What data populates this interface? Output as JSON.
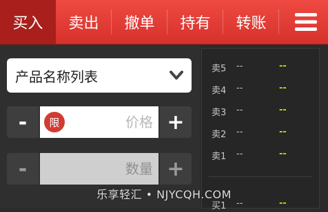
{
  "nav": {
    "tabs": [
      {
        "label": "买入",
        "active": true
      },
      {
        "label": "卖出",
        "active": false
      },
      {
        "label": "撤单",
        "active": false
      },
      {
        "label": "持有",
        "active": false
      },
      {
        "label": "转账",
        "active": false
      }
    ],
    "menu_icon": "hamburger-menu-icon"
  },
  "form": {
    "product_select": {
      "label": "产品名称列表",
      "icon": "chevron-down-icon"
    },
    "price": {
      "minus": "-",
      "plus": "+",
      "badge": "限",
      "placeholder": "价格"
    },
    "quantity": {
      "minus": "-",
      "plus": "+",
      "placeholder": "数量"
    }
  },
  "order_book": {
    "asks": [
      {
        "level": "卖5",
        "price": "--",
        "volume": "--"
      },
      {
        "level": "卖4",
        "price": "--",
        "volume": "--"
      },
      {
        "level": "卖3",
        "price": "--",
        "volume": "--"
      },
      {
        "level": "卖2",
        "price": "--",
        "volume": "--"
      },
      {
        "level": "卖1",
        "price": "--",
        "volume": "--"
      }
    ],
    "bids": [
      {
        "level": "买1",
        "price": "--",
        "volume": "--"
      }
    ]
  },
  "watermark": "乐享轻汇 • NJYCQH.COM",
  "colors": {
    "accent": "#d6312b",
    "accent_active": "#a91f1b",
    "volume": "#d9d200",
    "background": "#2b2b2b"
  }
}
